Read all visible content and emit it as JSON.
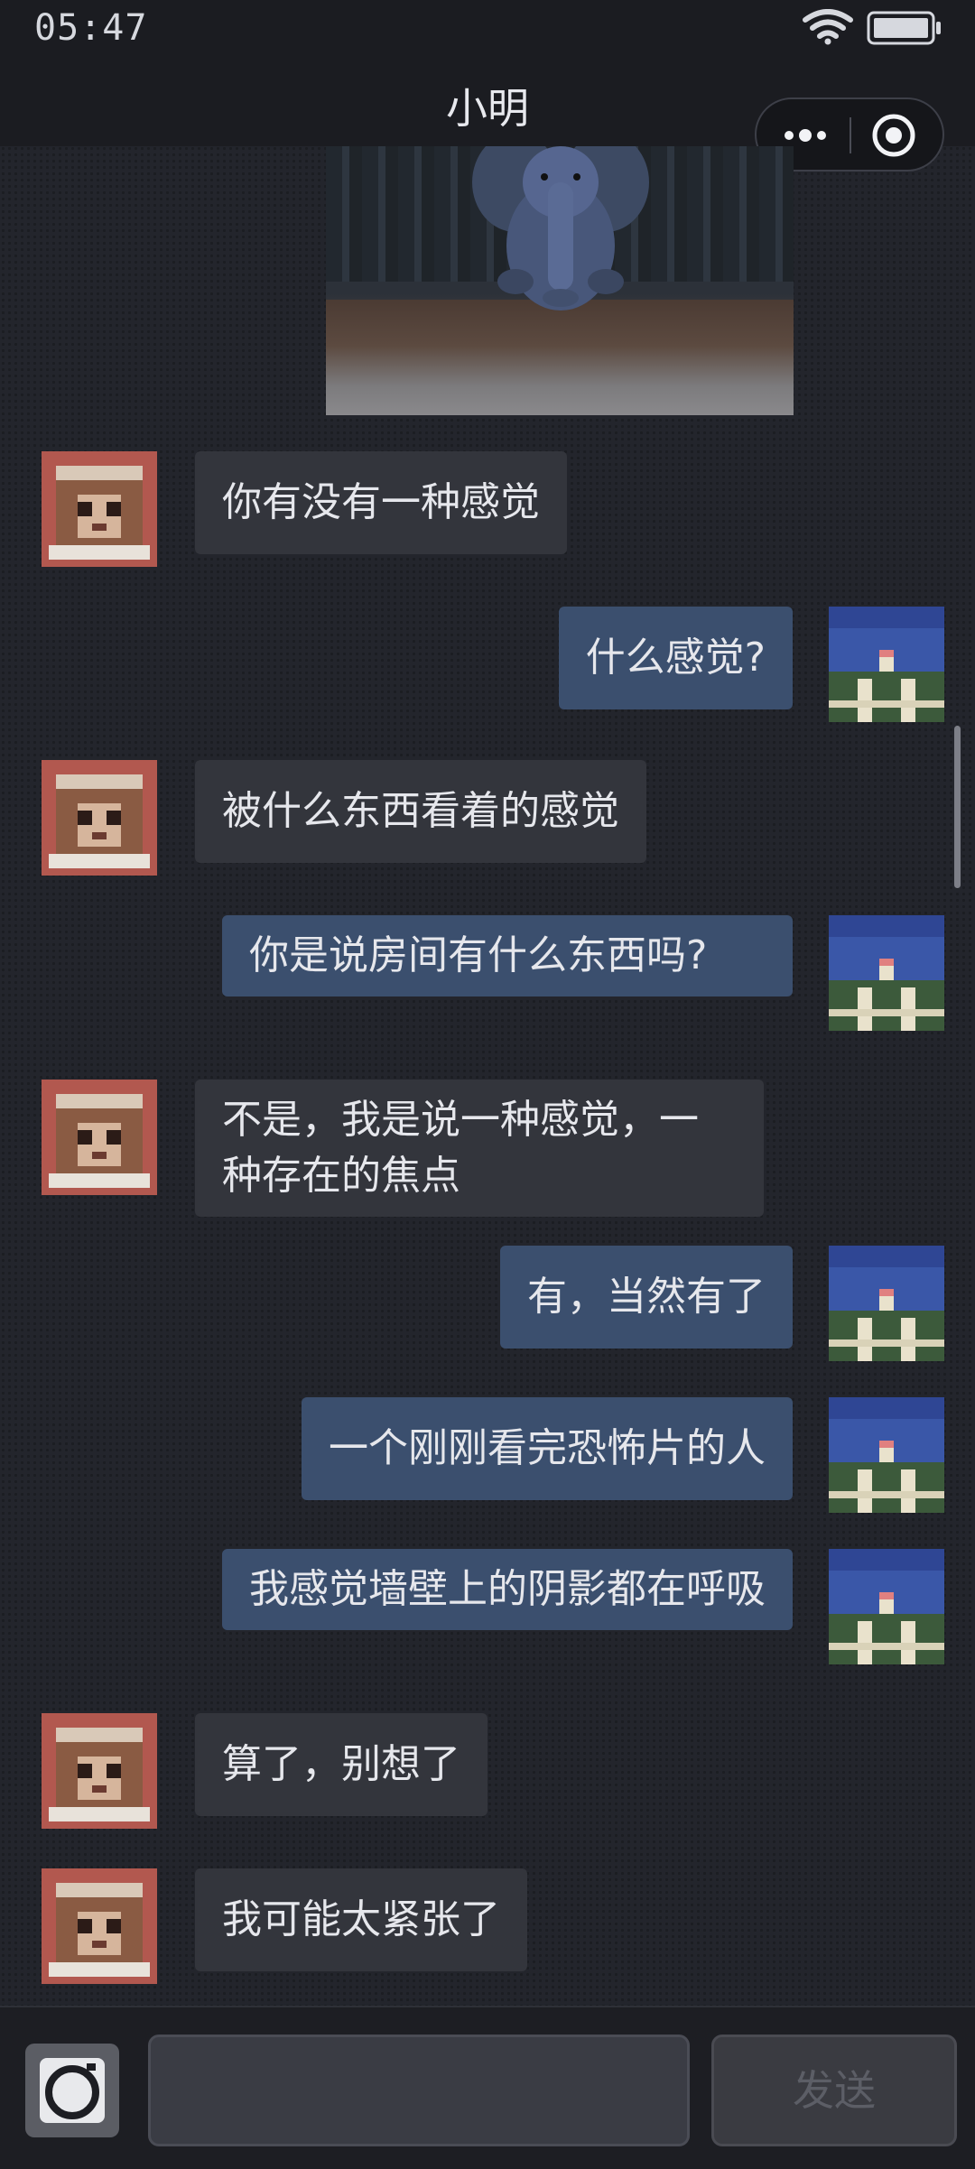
{
  "status": {
    "time": "05:47"
  },
  "header": {
    "title": "小明"
  },
  "messages": [
    {
      "side": "in",
      "text": "你有没有一种感觉"
    },
    {
      "side": "out",
      "text": "什么感觉?"
    },
    {
      "side": "in",
      "text": "被什么东西看着的感觉"
    },
    {
      "side": "out",
      "text": "你是说房间有什么东西吗?"
    },
    {
      "side": "in",
      "text": "不是，我是说一种感觉，一种存在的焦点"
    },
    {
      "side": "out",
      "text": "有，当然有了"
    },
    {
      "side": "out",
      "text": "一个刚刚看完恐怖片的人"
    },
    {
      "side": "out",
      "text": "我感觉墙壁上的阴影都在呼吸"
    },
    {
      "side": "in",
      "text": "算了，别想了"
    },
    {
      "side": "in",
      "text": "我可能太紧张了"
    }
  ],
  "input": {
    "placeholder": "",
    "send_label": "发送"
  },
  "colors": {
    "incoming_bubble": "#33353c",
    "outgoing_bubble": "#3b4f6e",
    "background": "#23252c"
  },
  "icons": {
    "status": [
      "wifi-icon",
      "battery-icon"
    ],
    "capsule": [
      "more-icon",
      "target-icon"
    ],
    "input": [
      "camera-icon"
    ]
  }
}
